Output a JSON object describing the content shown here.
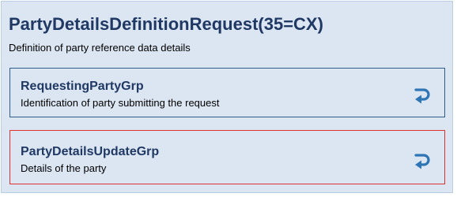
{
  "message": {
    "title": "PartyDetailsDefinitionRequest(35=CX)",
    "description": "Definition of party reference data details"
  },
  "groups": [
    {
      "name": "RequestingPartyGrp",
      "description": "Identification of party submitting the request",
      "border_color": "#2e5f8f",
      "icon": "return-arrow-icon"
    },
    {
      "name": "PartyDetailsUpdateGrp",
      "description": "Details of the party",
      "border_color": "#e03030",
      "icon": "return-arrow-icon"
    }
  ],
  "colors": {
    "background": "#dce6f2",
    "title": "#1f3864",
    "icon": "#2e75b6"
  }
}
